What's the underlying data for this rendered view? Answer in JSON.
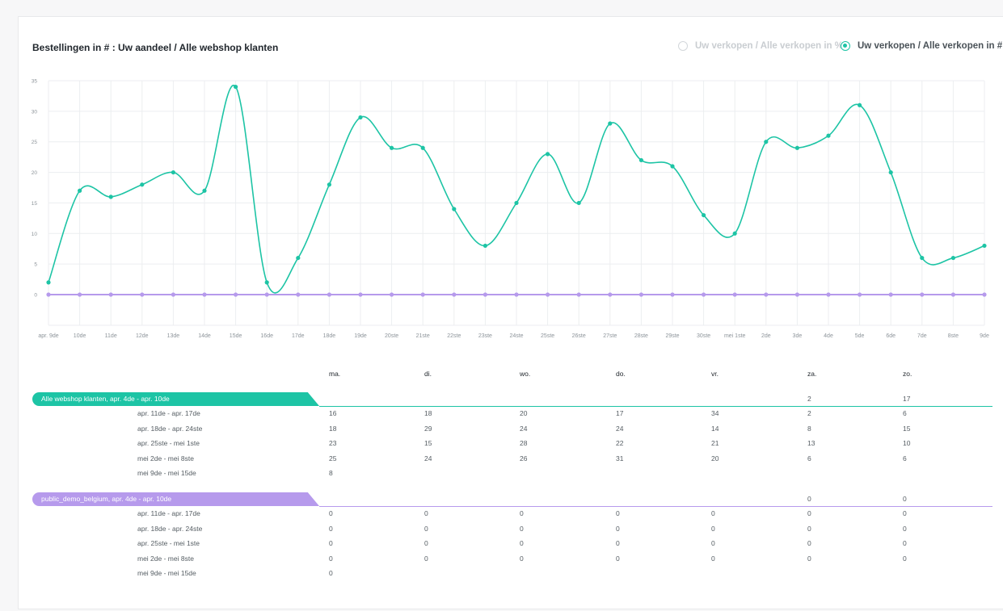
{
  "header": {
    "title": "Bestellingen in # : Uw aandeel / Alle webshop klanten",
    "toggle_percent": "Uw verkopen / Alle verkopen in %",
    "toggle_count": "Uw verkopen / Alle verkopen in #"
  },
  "colors": {
    "series_all": "#1dc4a5",
    "series_demo": "#b69aec",
    "grid": "#eceef0"
  },
  "chart_data": {
    "type": "line",
    "categories": [
      "apr. 9de",
      "10de",
      "11de",
      "12de",
      "13de",
      "14de",
      "15de",
      "16de",
      "17de",
      "18de",
      "19de",
      "20ste",
      "21ste",
      "22ste",
      "23ste",
      "24ste",
      "25ste",
      "26ste",
      "27ste",
      "28ste",
      "29ste",
      "30ste",
      "mei 1ste",
      "2de",
      "3de",
      "4de",
      "5de",
      "6de",
      "7de",
      "8ste",
      "9de"
    ],
    "series": [
      {
        "name": "Alle webshop klanten",
        "values": [
          2,
          17,
          16,
          18,
          20,
          17,
          34,
          2,
          6,
          18,
          29,
          24,
          24,
          14,
          8,
          15,
          23,
          15,
          28,
          22,
          21,
          13,
          10,
          25,
          24,
          26,
          31,
          20,
          6,
          6,
          8
        ]
      },
      {
        "name": "public_demo_belgium",
        "values": [
          0,
          0,
          0,
          0,
          0,
          0,
          0,
          0,
          0,
          0,
          0,
          0,
          0,
          0,
          0,
          0,
          0,
          0,
          0,
          0,
          0,
          0,
          0,
          0,
          0,
          0,
          0,
          0,
          0,
          0,
          0
        ]
      }
    ],
    "ylim": [
      0,
      35
    ],
    "yticks": [
      0,
      5,
      10,
      15,
      20,
      25,
      30,
      35
    ],
    "grid": true
  },
  "table": {
    "days": [
      "ma.",
      "di.",
      "wo.",
      "do.",
      "vr.",
      "za.",
      "zo."
    ],
    "groups": [
      {
        "label": "Alle webshop klanten, apr. 4de - apr. 10de",
        "first_row": [
          "",
          "",
          "",
          "",
          "",
          "2",
          "17"
        ],
        "rows": [
          {
            "label": "apr. 11de - apr. 17de",
            "values": [
              "16",
              "18",
              "20",
              "17",
              "34",
              "2",
              "6"
            ]
          },
          {
            "label": "apr. 18de - apr. 24ste",
            "values": [
              "18",
              "29",
              "24",
              "24",
              "14",
              "8",
              "15"
            ]
          },
          {
            "label": "apr. 25ste - mei 1ste",
            "values": [
              "23",
              "15",
              "28",
              "22",
              "21",
              "13",
              "10"
            ]
          },
          {
            "label": "mei 2de - mei 8ste",
            "values": [
              "25",
              "24",
              "26",
              "31",
              "20",
              "6",
              "6"
            ]
          },
          {
            "label": "mei 9de - mei 15de",
            "values": [
              "8",
              "",
              "",
              "",
              "",
              "",
              ""
            ]
          }
        ]
      },
      {
        "label": "public_demo_belgium, apr. 4de - apr. 10de",
        "first_row": [
          "",
          "",
          "",
          "",
          "",
          "0",
          "0"
        ],
        "rows": [
          {
            "label": "apr. 11de - apr. 17de",
            "values": [
              "0",
              "0",
              "0",
              "0",
              "0",
              "0",
              "0"
            ]
          },
          {
            "label": "apr. 18de - apr. 24ste",
            "values": [
              "0",
              "0",
              "0",
              "0",
              "0",
              "0",
              "0"
            ]
          },
          {
            "label": "apr. 25ste - mei 1ste",
            "values": [
              "0",
              "0",
              "0",
              "0",
              "0",
              "0",
              "0"
            ]
          },
          {
            "label": "mei 2de - mei 8ste",
            "values": [
              "0",
              "0",
              "0",
              "0",
              "0",
              "0",
              "0"
            ]
          },
          {
            "label": "mei 9de - mei 15de",
            "values": [
              "0",
              "",
              "",
              "",
              "",
              "",
              ""
            ]
          }
        ]
      }
    ]
  }
}
